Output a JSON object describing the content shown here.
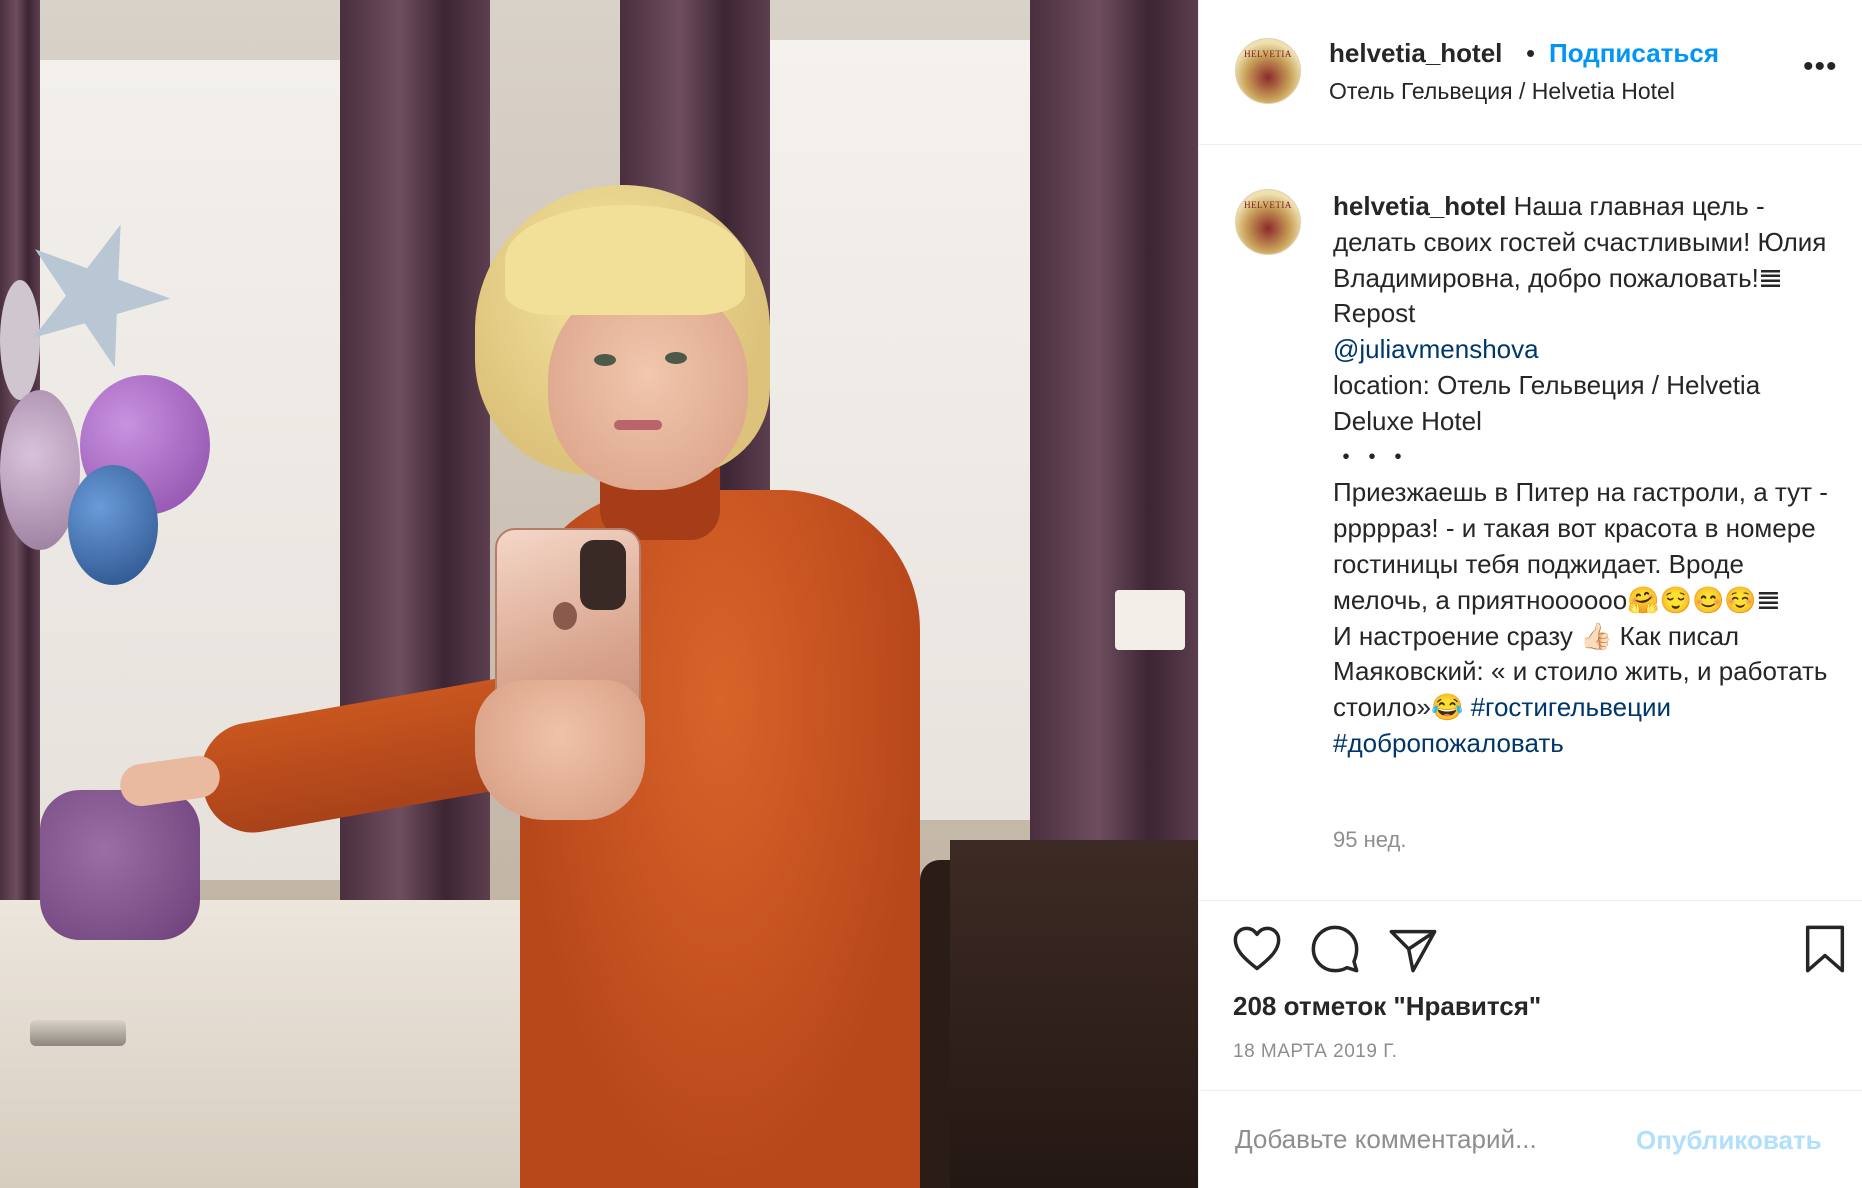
{
  "header": {
    "username": "helvetia_hotel",
    "separator": "•",
    "follow_label": "Подписаться",
    "location": "Отель Гельвеция / Helvetia Hotel",
    "more_label": "•••",
    "avatar_text": "HELVETIA"
  },
  "caption": {
    "username": "helvetia_hotel",
    "text1": "Наша главная цель - делать своих гостей счастливыми! Юлия Владимировна, добро пожаловать!𝌆 Repost",
    "mention": "@juliavmenshova",
    "location_line": "location: Отель Гельвеция / Helvetia Deluxe Hotel",
    "dots": "・・・",
    "para2": "Приезжаешь в Питер на гастроли, а тут - ррррраз! - и такая вот красота в номере гостиницы тебя поджидает. Вроде мелочь, а приятноооооо🤗😌😊☺️𝌆",
    "para3_text": "И настроение сразу 👍🏻 Как писал Маяковский: « и стоило жить, и работать стоило»😂 ",
    "hashtag1": "#гостигельвеции",
    "hashtag2": "#добропожаловать",
    "time_ago": "95 нед."
  },
  "actions": {
    "likes": "208 отметок \"Нравится\"",
    "date": "18 МАРТА 2019 Г."
  },
  "comment": {
    "placeholder": "Добавьте комментарий...",
    "publish_label": "Опубликовать"
  },
  "icons": {
    "like": "heart-icon",
    "comment": "comment-icon",
    "share": "paper-plane-icon",
    "save": "bookmark-icon"
  },
  "colors": {
    "accent": "#0095f6",
    "link": "#00376b",
    "muted": "#8e8e8e",
    "publish_disabled": "#b2dffc"
  }
}
